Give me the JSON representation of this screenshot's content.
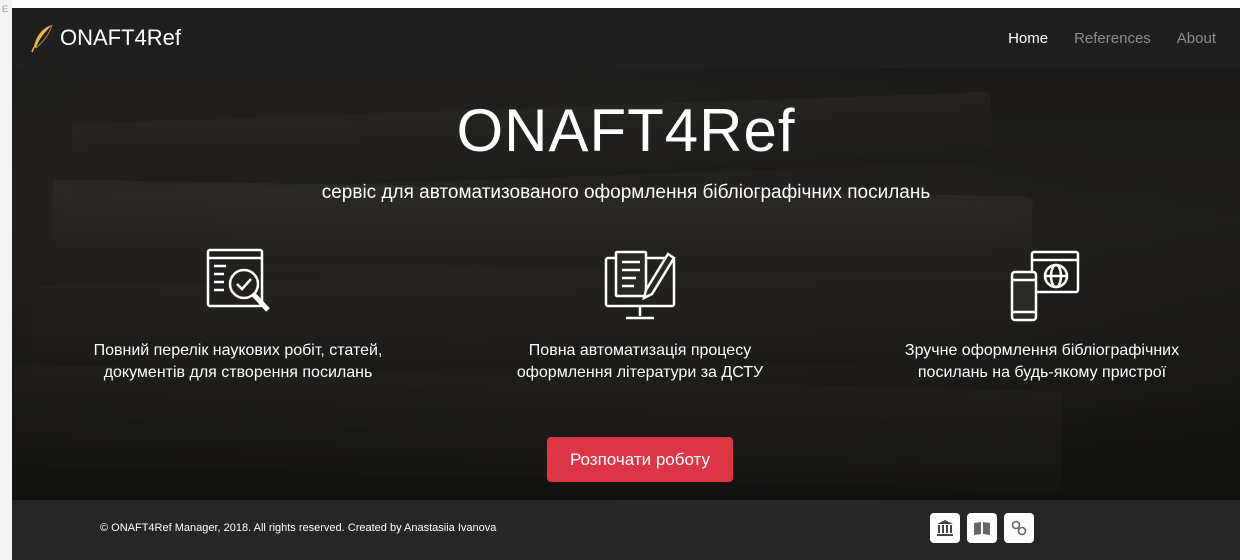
{
  "edge_mark": "E",
  "brand": {
    "name": "ONAFT4Ref",
    "logo_icon": "quill-icon",
    "logo_color": "#e0b84a"
  },
  "nav": {
    "items": [
      {
        "label": "Home",
        "active": true
      },
      {
        "label": "References",
        "active": false
      },
      {
        "label": "About",
        "active": false
      }
    ]
  },
  "hero": {
    "title": "ONAFT4Ref",
    "subtitle": "сервіс для автоматизованого оформлення бібліографічних посилань",
    "features": [
      {
        "icon": "document-search-icon",
        "text": "Повний перелік наукових робіт, статей, документів для створення посилань"
      },
      {
        "icon": "monitor-document-pen-icon",
        "text": "Повна автоматизація процесу оформлення літератури за ДСТУ"
      },
      {
        "icon": "phone-globe-icon",
        "text": "Зручне оформлення бібліографічних посилань на будь-якому пристрої"
      }
    ],
    "cta_label": "Розпочати роботу",
    "cta_color": "#dc3545"
  },
  "footer": {
    "copyright": "© ONAFT4Ref Manager, 2018. All rights reserved. Created by Anastasiia Ivanova",
    "icons": [
      "university-icon",
      "book-icon",
      "link-icon"
    ]
  }
}
